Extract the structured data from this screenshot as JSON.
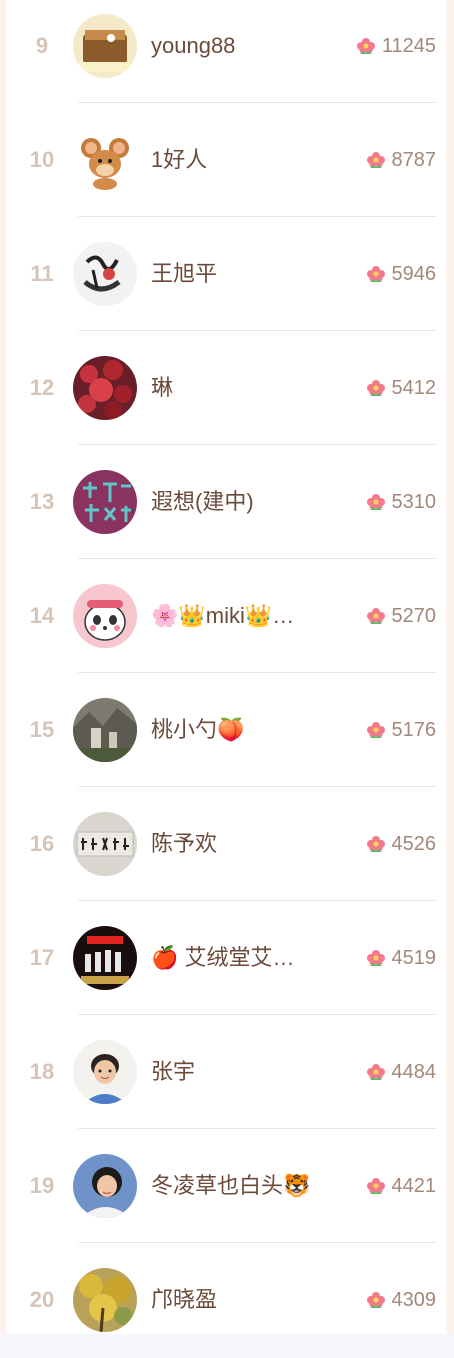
{
  "rows": [
    {
      "rank": "9",
      "name": "young88",
      "score": "11245",
      "avatar": "cake-photo-avatar"
    },
    {
      "rank": "10",
      "name": "1好人",
      "score": "8787",
      "avatar": "cartoon-mouse-avatar"
    },
    {
      "rank": "11",
      "name": "王旭平",
      "score": "5946",
      "avatar": "ink-calligraphy-avatar"
    },
    {
      "rank": "12",
      "name": "琳",
      "score": "5412",
      "avatar": "red-leaves-avatar"
    },
    {
      "rank": "13",
      "name": "遐想(建中)",
      "score": "5310",
      "avatar": "calligraphy-text-avatar"
    },
    {
      "rank": "14",
      "name": "🌸👑miki👑…",
      "score": "5270",
      "avatar": "cartoon-panda-avatar"
    },
    {
      "rank": "15",
      "name": "桃小勺🍑",
      "score": "5176",
      "avatar": "landscape-photo-avatar"
    },
    {
      "rank": "16",
      "name": "陈予欢",
      "score": "4526",
      "avatar": "calligraphy-plaque-avatar"
    },
    {
      "rank": "17",
      "name": "🍎 艾绒堂艾…",
      "score": "4519",
      "avatar": "product-bottles-avatar"
    },
    {
      "rank": "18",
      "name": "张宇",
      "score": "4484",
      "avatar": "woman-portrait-avatar"
    },
    {
      "rank": "19",
      "name": "冬凌草也白头🐯",
      "score": "4421",
      "avatar": "woman-smiling-avatar"
    },
    {
      "rank": "20",
      "name": "邝晓盈",
      "score": "4309",
      "avatar": "autumn-tree-avatar"
    }
  ],
  "score_icon": "flower-icon",
  "colors": {
    "rank": "#d6c4b8",
    "name": "#6b4a3a",
    "score": "#a3877a",
    "flower": "#f27a8a",
    "panel": "#fdf3ee"
  }
}
